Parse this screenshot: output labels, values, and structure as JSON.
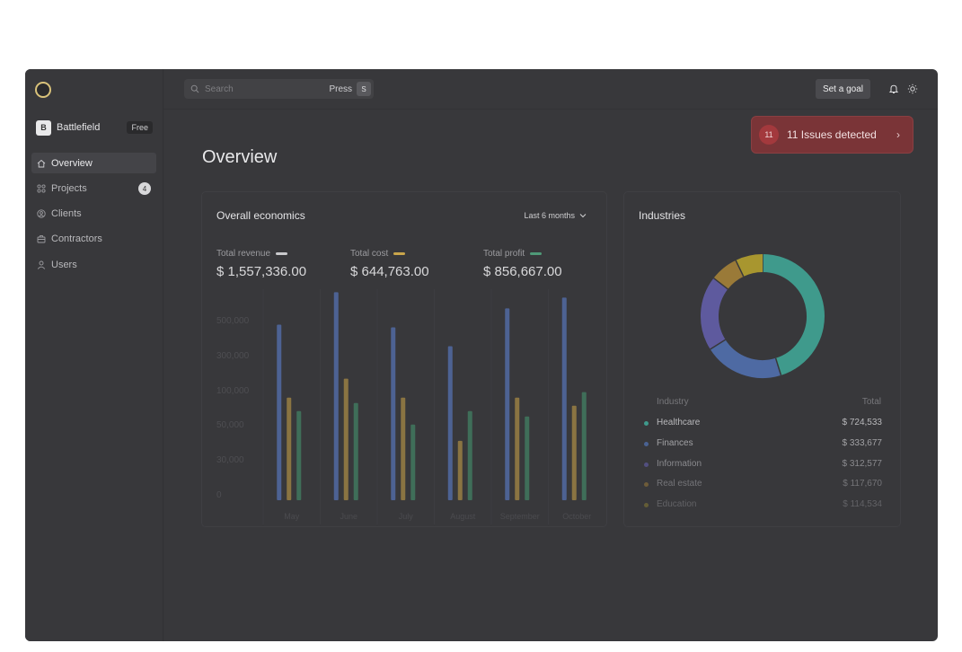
{
  "sidebar": {
    "workspace": {
      "initial": "B",
      "name": "Battlefield",
      "plan": "Free"
    },
    "items": [
      {
        "label": "Overview",
        "icon": "home-icon",
        "active": true
      },
      {
        "label": "Projects",
        "icon": "grid-icon",
        "badge": "4"
      },
      {
        "label": "Clients",
        "icon": "user-circle-icon"
      },
      {
        "label": "Contractors",
        "icon": "briefcase-icon"
      },
      {
        "label": "Users",
        "icon": "user-icon"
      }
    ]
  },
  "topbar": {
    "search_placeholder": "Search",
    "press_label": "Press",
    "shortcut_key": "S",
    "goal_button": "Set a goal"
  },
  "notice": {
    "count": "11",
    "text": "11 Issues detected"
  },
  "page": {
    "title": "Overview"
  },
  "economics": {
    "title": "Overall economics",
    "range": "Last 6 months",
    "metrics": [
      {
        "label": "Total revenue",
        "value": "$ 1,557,336.00",
        "color": "#c9c9cc"
      },
      {
        "label": "Total cost",
        "value": "$ 644,763.00",
        "color": "#c9a54b"
      },
      {
        "label": "Total profit",
        "value": "$ 856,667.00",
        "color": "#4f9a78"
      }
    ]
  },
  "industries": {
    "title": "Industries",
    "col_industry": "Industry",
    "col_total": "Total",
    "rows": [
      {
        "name": "Healthcare",
        "total": "$ 724,533",
        "color": "#3f9a8c"
      },
      {
        "name": "Finances",
        "total": "$ 333,677",
        "color": "#4e6aa3"
      },
      {
        "name": "Information",
        "total": "$ 312,577",
        "color": "#5e5a9e"
      },
      {
        "name": "Real estate",
        "total": "$ 117,670",
        "color": "#9a7a38"
      },
      {
        "name": "Education",
        "total": "$ 114,534",
        "color": "#a8962f"
      }
    ]
  },
  "chart_data": [
    {
      "type": "bar",
      "categories": [
        "May",
        "June",
        "July",
        "August",
        "September",
        "October"
      ],
      "yticks": [
        "500,000",
        "300,000",
        "100,000",
        "50,000",
        "30,000",
        "0"
      ],
      "series": [
        {
          "name": "Total revenue",
          "color": "#4d6293",
          "values": [
            0.65,
            0.77,
            0.64,
            0.57,
            0.71,
            0.75
          ]
        },
        {
          "name": "Total cost",
          "color": "#8a7442",
          "values": [
            0.38,
            0.45,
            0.38,
            0.22,
            0.38,
            0.35
          ]
        },
        {
          "name": "Total profit",
          "color": "#3f6e59",
          "values": [
            0.33,
            0.36,
            0.28,
            0.33,
            0.31,
            0.4
          ]
        }
      ]
    },
    {
      "type": "pie",
      "categories": [
        "Healthcare",
        "Finances",
        "Information",
        "Real estate",
        "Education"
      ],
      "values": [
        724533,
        333677,
        312577,
        117670,
        114534
      ],
      "colors": [
        "#3f9a8c",
        "#4e6aa3",
        "#5e5a9e",
        "#9a7a38",
        "#a8962f"
      ]
    }
  ]
}
